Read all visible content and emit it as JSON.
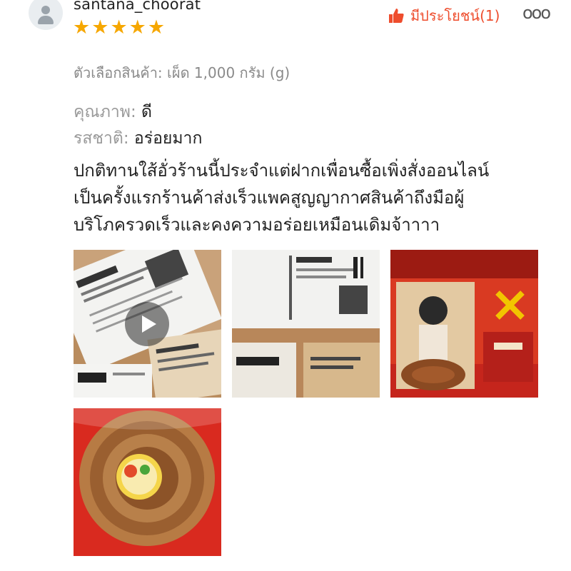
{
  "review": {
    "username": "santana_choorat",
    "rating": 5,
    "helpful_label": "มีประโยชน์(1)",
    "more_label": "ooo",
    "variation": "ตัวเลือกสินค้า: เผ็ด 1,000 กรัม (g)",
    "attributes": [
      {
        "key": "คุณภาพ:",
        "value": "ดี"
      },
      {
        "key": "รสชาติ:",
        "value": "อร่อยมาก"
      }
    ],
    "comment_lines": [
      "ปกติทานใส้อั่วร้านนี้ประจำแต่ฝากเพื่อนซื้อเพิ่งสั่งออนไลน์",
      "เป็นครั้งแรกร้านค้าส่งเร็วแพคสูญญากาศสินค้าถึงมือผู้",
      "บริโภครวดเร็วและคงความอร่อยเหมือนเดิมจ้าาาา"
    ]
  },
  "icons": {
    "avatar": "user-avatar-icon",
    "star": "star-icon",
    "helpful": "thumbs-up-icon",
    "play": "play-icon"
  },
  "colors": {
    "star": "#f6a700",
    "accent": "#ee4d2d",
    "muted_text": "#8a8a8a"
  }
}
